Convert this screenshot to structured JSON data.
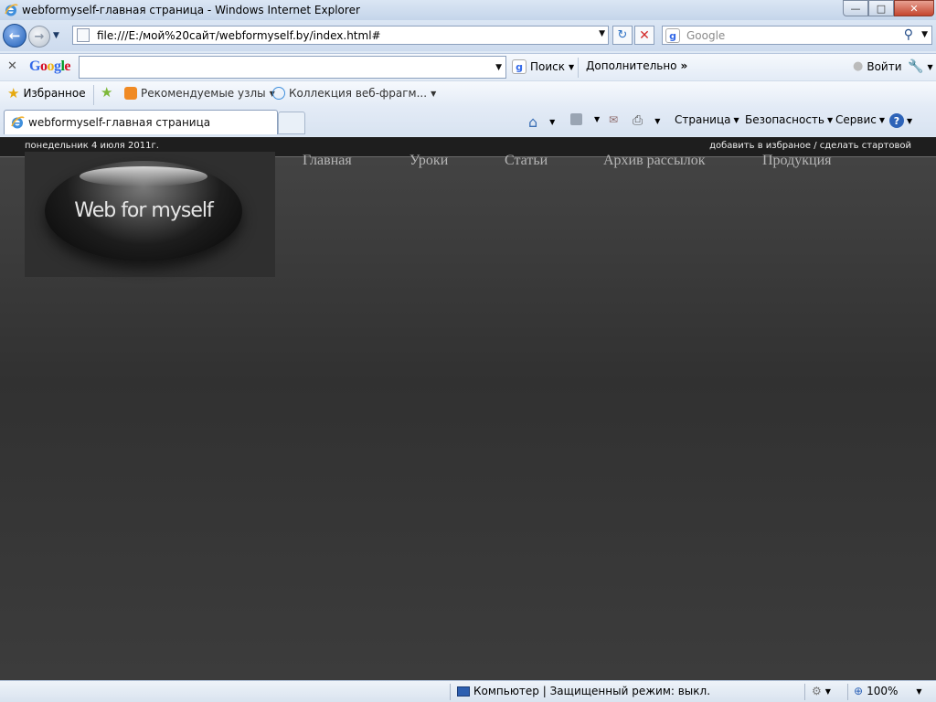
{
  "window": {
    "title": "webformyself-главная страница - Windows Internet Explorer",
    "minimize": "—",
    "maximize": "□",
    "close": "✕"
  },
  "nav": {
    "url": "file:///E:/мой%20сайт/webformyself.by/index.html#",
    "search_placeholder": "Google"
  },
  "google_toolbar": {
    "logo_letters": [
      "G",
      "o",
      "o",
      "g",
      "l",
      "e"
    ],
    "search_label": "Поиск",
    "more_label": "Дополнительно",
    "signin_label": "Войти"
  },
  "favorites": {
    "favorites_label": "Избранное",
    "suggested_label": "Рекомендуемые узлы",
    "gallery_label": "Коллекция веб-фрагм..."
  },
  "tab": {
    "title": "webformyself-главная страница"
  },
  "command_bar": {
    "page_label": "Страница",
    "safety_label": "Безопасность",
    "tools_label": "Сервис"
  },
  "site": {
    "date": "понедельник 4 июля 2011г.",
    "top_links": "добавить в избраное / сделать стартовой",
    "logo_text": "Web for myself",
    "menu": [
      "Главная",
      "Уроки",
      "Статьи",
      "Архив рассылок",
      "Продукция"
    ]
  },
  "status": {
    "zone": "Компьютер | Защищенный режим: выкл.",
    "zoom": "100%"
  },
  "colors": {
    "page_dark": "#313131",
    "menu_text": "#b5b5b5",
    "ie_frame": "#dfe9f5"
  }
}
